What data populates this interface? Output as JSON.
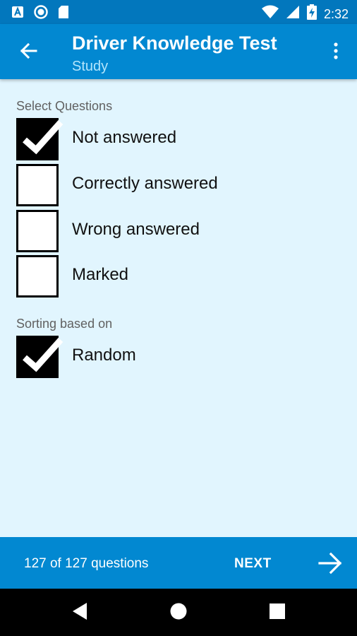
{
  "status_bar": {
    "time": "2:32",
    "left_icons": [
      "a-notification-icon",
      "circle-notification-icon",
      "sd-card-icon"
    ],
    "right_icons": [
      "wifi-icon",
      "signal-icon",
      "battery-charging-icon"
    ]
  },
  "app_bar": {
    "title": "Driver Knowledge Test",
    "subtitle": "Study",
    "back_icon": "arrow-back-icon",
    "menu_icon": "more-vert-icon"
  },
  "select_questions": {
    "label": "Select Questions",
    "options": [
      {
        "label": "Not answered",
        "checked": true
      },
      {
        "label": "Correctly answered",
        "checked": false
      },
      {
        "label": "Wrong answered",
        "checked": false
      },
      {
        "label": "Marked",
        "checked": false
      }
    ]
  },
  "sorting": {
    "label": "Sorting based on",
    "options": [
      {
        "label": "Random",
        "checked": true
      }
    ]
  },
  "bottom_bar": {
    "count": "127 of 127 questions",
    "next_label": "NEXT",
    "next_icon": "arrow-forward-icon"
  },
  "nav_bar": {
    "icons": [
      "back-triangle-icon",
      "home-circle-icon",
      "recents-square-icon"
    ]
  },
  "colors": {
    "status_bar": "#0277bd",
    "app_bar": "#0288d1",
    "background": "#e1f5fe",
    "subtitle": "#b3e5fc"
  }
}
